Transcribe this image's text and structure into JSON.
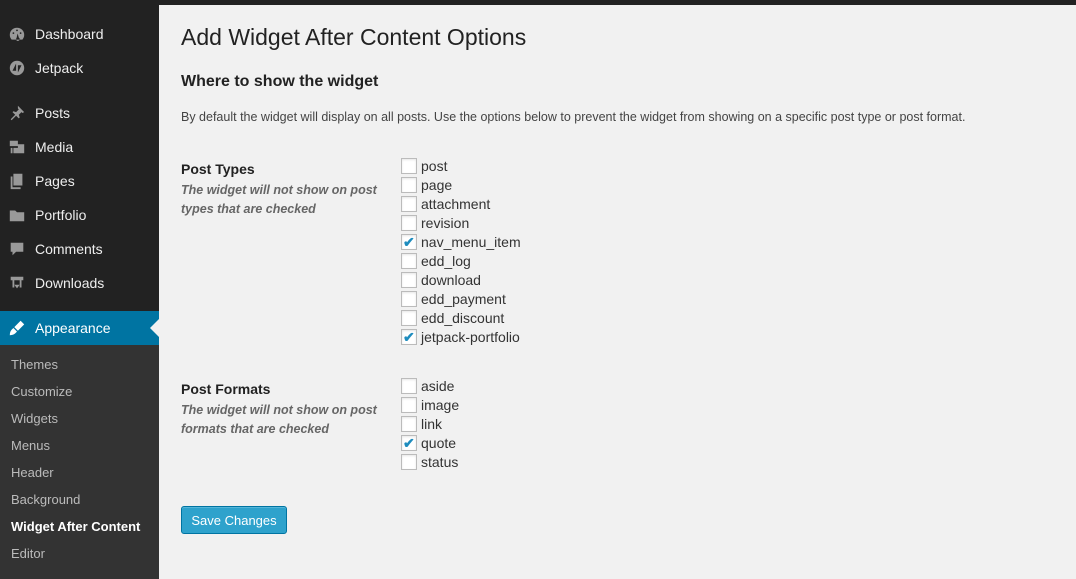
{
  "sidebar": {
    "items": [
      {
        "label": "Dashboard",
        "icon": "dashboard-icon"
      },
      {
        "label": "Jetpack",
        "icon": "jetpack-icon"
      },
      {
        "label": "Posts",
        "icon": "pushpin-icon"
      },
      {
        "label": "Media",
        "icon": "media-icon"
      },
      {
        "label": "Pages",
        "icon": "pages-icon"
      },
      {
        "label": "Portfolio",
        "icon": "folder-icon"
      },
      {
        "label": "Comments",
        "icon": "comment-icon"
      },
      {
        "label": "Downloads",
        "icon": "download-icon"
      },
      {
        "label": "Appearance",
        "icon": "paintbrush-icon",
        "active": true
      }
    ],
    "submenu": [
      "Themes",
      "Customize",
      "Widgets",
      "Menus",
      "Header",
      "Background",
      "Widget After Content",
      "Editor"
    ],
    "submenu_current": "Widget After Content"
  },
  "page": {
    "title": "Add Widget After Content Options",
    "section_title": "Where to show the widget",
    "description": "By default the widget will display on all posts. Use the options below to prevent the widget from showing on a specific post type or post format."
  },
  "post_types": {
    "label": "Post Types",
    "hint": "The widget will not show on post types that are checked",
    "options": [
      {
        "label": "post",
        "checked": false
      },
      {
        "label": "page",
        "checked": false
      },
      {
        "label": "attachment",
        "checked": false
      },
      {
        "label": "revision",
        "checked": false
      },
      {
        "label": "nav_menu_item",
        "checked": true
      },
      {
        "label": "edd_log",
        "checked": false
      },
      {
        "label": "download",
        "checked": false
      },
      {
        "label": "edd_payment",
        "checked": false
      },
      {
        "label": "edd_discount",
        "checked": false
      },
      {
        "label": "jetpack-portfolio",
        "checked": true
      }
    ]
  },
  "post_formats": {
    "label": "Post Formats",
    "hint": "The widget will not show on post formats that are checked",
    "options": [
      {
        "label": "aside",
        "checked": false
      },
      {
        "label": "image",
        "checked": false
      },
      {
        "label": "link",
        "checked": false
      },
      {
        "label": "quote",
        "checked": true
      },
      {
        "label": "status",
        "checked": false
      }
    ]
  },
  "save_label": "Save Changes",
  "colors": {
    "accent": "#0074a2",
    "button": "#2ea2cc",
    "check": "#1e8cbe"
  }
}
